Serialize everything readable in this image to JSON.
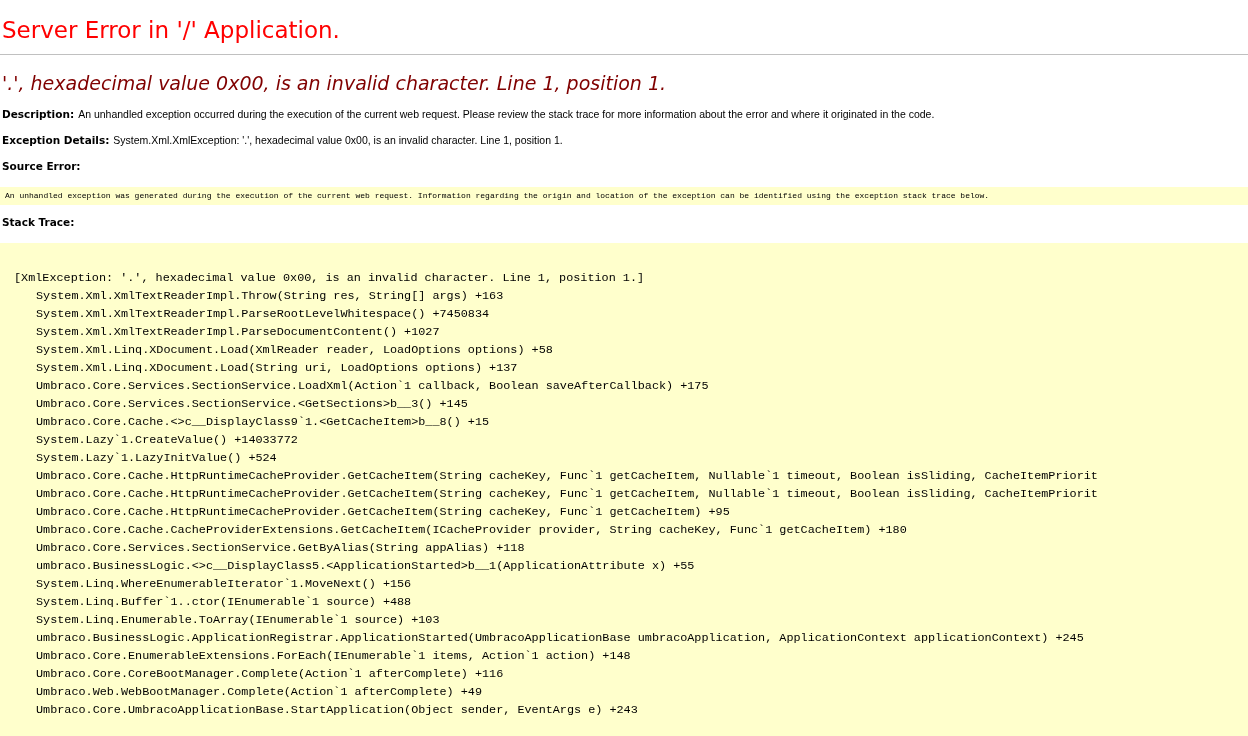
{
  "title": "Server Error in '/' Application.",
  "error_message": "'.', hexadecimal value 0x00, is an invalid character. Line 1, position 1.",
  "details": [
    {
      "label": "Description:",
      "value": "An unhandled exception occurred during the execution of the current web request. Please review the stack trace for more information about the error and where it originated in the code."
    },
    {
      "label": "Exception Details:",
      "value": "System.Xml.XmlException: '.', hexadecimal value 0x00, is an invalid character. Line 1, position 1."
    }
  ],
  "source_error": {
    "label": "Source Error:",
    "text": "An unhandled exception was generated during the execution of the current web request. Information regarding the origin and location of the exception can be identified using the exception stack trace below."
  },
  "stack_trace": {
    "label": "Stack Trace:",
    "lines": [
      {
        "kind": "header",
        "text": "[XmlException: '.', hexadecimal value 0x00, is an invalid character. Line 1, position 1.]"
      },
      {
        "kind": "frame",
        "text": "System.Xml.XmlTextReaderImpl.Throw(String res, String[] args) +163"
      },
      {
        "kind": "frame",
        "text": "System.Xml.XmlTextReaderImpl.ParseRootLevelWhitespace() +7450834"
      },
      {
        "kind": "frame",
        "text": "System.Xml.XmlTextReaderImpl.ParseDocumentContent() +1027"
      },
      {
        "kind": "frame",
        "text": "System.Xml.Linq.XDocument.Load(XmlReader reader, LoadOptions options) +58"
      },
      {
        "kind": "frame",
        "text": "System.Xml.Linq.XDocument.Load(String uri, LoadOptions options) +137"
      },
      {
        "kind": "frame",
        "text": "Umbraco.Core.Services.SectionService.LoadXml(Action`1 callback, Boolean saveAfterCallback) +175"
      },
      {
        "kind": "frame",
        "text": "Umbraco.Core.Services.SectionService.<GetSections>b__3() +145"
      },
      {
        "kind": "frame",
        "text": "Umbraco.Core.Cache.<>c__DisplayClass9`1.<GetCacheItem>b__8() +15"
      },
      {
        "kind": "frame",
        "text": "System.Lazy`1.CreateValue() +14033772"
      },
      {
        "kind": "frame",
        "text": "System.Lazy`1.LazyInitValue() +524"
      },
      {
        "kind": "frame",
        "text": "Umbraco.Core.Cache.HttpRuntimeCacheProvider.GetCacheItem(String cacheKey, Func`1 getCacheItem, Nullable`1 timeout, Boolean isSliding, CacheItemPriorit"
      },
      {
        "kind": "frame",
        "text": "Umbraco.Core.Cache.HttpRuntimeCacheProvider.GetCacheItem(String cacheKey, Func`1 getCacheItem, Nullable`1 timeout, Boolean isSliding, CacheItemPriorit"
      },
      {
        "kind": "frame",
        "text": "Umbraco.Core.Cache.HttpRuntimeCacheProvider.GetCacheItem(String cacheKey, Func`1 getCacheItem) +95"
      },
      {
        "kind": "frame",
        "text": "Umbraco.Core.Cache.CacheProviderExtensions.GetCacheItem(ICacheProvider provider, String cacheKey, Func`1 getCacheItem) +180"
      },
      {
        "kind": "frame",
        "text": "Umbraco.Core.Services.SectionService.GetByAlias(String appAlias) +118"
      },
      {
        "kind": "frame",
        "text": "umbraco.BusinessLogic.<>c__DisplayClass5.<ApplicationStarted>b__1(ApplicationAttribute x) +55"
      },
      {
        "kind": "frame",
        "text": "System.Linq.WhereEnumerableIterator`1.MoveNext() +156"
      },
      {
        "kind": "frame",
        "text": "System.Linq.Buffer`1..ctor(IEnumerable`1 source) +488"
      },
      {
        "kind": "frame",
        "text": "System.Linq.Enumerable.ToArray(IEnumerable`1 source) +103"
      },
      {
        "kind": "frame",
        "text": "umbraco.BusinessLogic.ApplicationRegistrar.ApplicationStarted(UmbracoApplicationBase umbracoApplication, ApplicationContext applicationContext) +245"
      },
      {
        "kind": "frame",
        "text": "Umbraco.Core.EnumerableExtensions.ForEach(IEnumerable`1 items, Action`1 action) +148"
      },
      {
        "kind": "frame",
        "text": "Umbraco.Core.CoreBootManager.Complete(Action`1 afterComplete) +116"
      },
      {
        "kind": "frame",
        "text": "Umbraco.Web.WebBootManager.Complete(Action`1 afterComplete) +49"
      },
      {
        "kind": "frame",
        "text": "Umbraco.Core.UmbracoApplicationBase.StartApplication(Object sender, EventArgs e) +243"
      }
    ]
  }
}
